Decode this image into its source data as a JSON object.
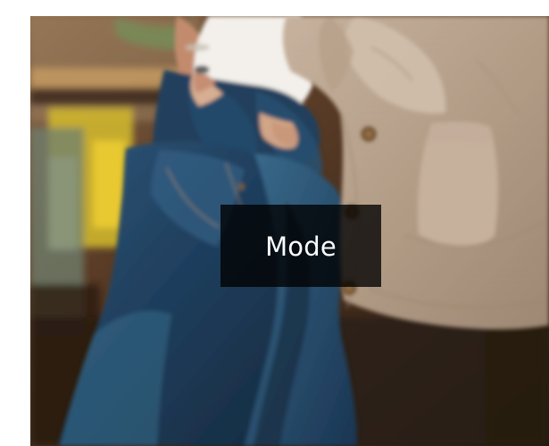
{
  "category_tile": {
    "label": "Mode",
    "image_subject": "person-wearing-jeans-and-cardigan"
  },
  "colors": {
    "label_background": "#000000",
    "label_text": "#ffffff",
    "denim": "#244867",
    "cardigan": "#b6a18d",
    "shirt": "#f2f0eb",
    "background_wood": "#5a3b26",
    "yellow_stool": "#d2b527",
    "green_stool": "#657a69"
  }
}
